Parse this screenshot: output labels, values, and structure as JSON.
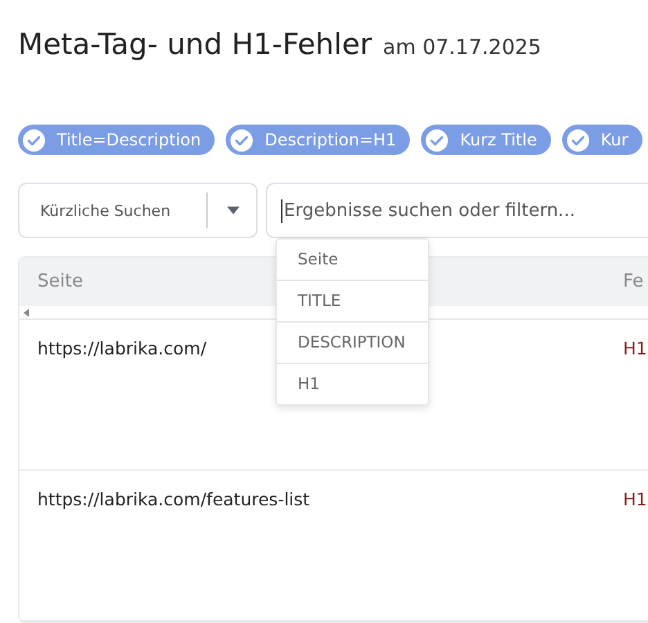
{
  "header": {
    "title": "Meta-Tag- und H1-Fehler",
    "date": "am 07.17.2025"
  },
  "filters": [
    {
      "label": "Title=Description",
      "checked": true
    },
    {
      "label": "Description=H1",
      "checked": true
    },
    {
      "label": "Kurz Title",
      "checked": true
    },
    {
      "label": "Kur",
      "checked": true
    }
  ],
  "recent_searches": {
    "label": "Kürzliche Suchen"
  },
  "search": {
    "placeholder": "Ergebnisse suchen oder filtern..."
  },
  "column_menu": [
    "Seite",
    "TITLE",
    "DESCRIPTION",
    "H1"
  ],
  "table": {
    "columns": [
      "Seite",
      "Fe"
    ],
    "rows": [
      {
        "page": "https://labrika.com/",
        "error": "H1"
      },
      {
        "page": "https://labrika.com/features-list",
        "error": "H1"
      }
    ]
  }
}
